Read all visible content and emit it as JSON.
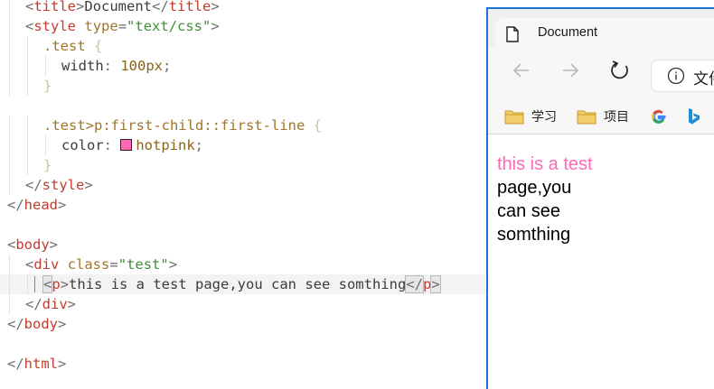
{
  "editor": {
    "lines": [
      {
        "kind": "tag-text",
        "indent": 1,
        "tag": "title",
        "text": "Document"
      },
      {
        "kind": "style-open",
        "indent": 1,
        "tag": "style",
        "attr": "type",
        "value": "\"text/css\""
      },
      {
        "kind": "selector",
        "indent": 2,
        "selector": ".test",
        "brace": "{"
      },
      {
        "kind": "decl",
        "indent": 3,
        "prop": "width",
        "value": "100px"
      },
      {
        "kind": "close-brace",
        "indent": 2,
        "brace": "}"
      },
      {
        "kind": "blank"
      },
      {
        "kind": "selector",
        "indent": 2,
        "selector": ".test>p:first-child::first-line",
        "brace": "{"
      },
      {
        "kind": "decl-color",
        "indent": 3,
        "prop": "color",
        "value": "hotpink",
        "swatch": "#ff69b4"
      },
      {
        "kind": "close-brace",
        "indent": 2,
        "brace": "}"
      },
      {
        "kind": "close-tag",
        "indent": 1,
        "tag": "style"
      },
      {
        "kind": "close-tag",
        "indent": 0,
        "tag": "head"
      },
      {
        "kind": "blank"
      },
      {
        "kind": "open-tag",
        "indent": 0,
        "tag": "body"
      },
      {
        "kind": "open-attr",
        "indent": 1,
        "tag": "div",
        "attr": "class",
        "value": "\"test\""
      },
      {
        "kind": "current-p",
        "indent": 2,
        "tag": "p",
        "text": "this is a test page,you can see somthing"
      },
      {
        "kind": "close-tag",
        "indent": 1,
        "tag": "div"
      },
      {
        "kind": "close-tag",
        "indent": 0,
        "tag": "body"
      },
      {
        "kind": "blank"
      },
      {
        "kind": "close-tag",
        "indent": 0,
        "tag": "html"
      }
    ]
  },
  "browser": {
    "tab_title": "Document",
    "address_text": "文件",
    "bookmarks": [
      {
        "label": "学习",
        "icon": "folder-icon"
      },
      {
        "label": "项目",
        "icon": "folder-icon"
      },
      {
        "label": "",
        "icon": "google-icon"
      },
      {
        "label": "",
        "icon": "bing-icon"
      }
    ],
    "page": {
      "first_line": "this is a test",
      "rest": "page,you can see somthing"
    }
  },
  "colors": {
    "hotpink": "#ff69b4",
    "window_border": "#1b73d3",
    "tag": "#c53a2c",
    "string": "#3f8f3a"
  }
}
